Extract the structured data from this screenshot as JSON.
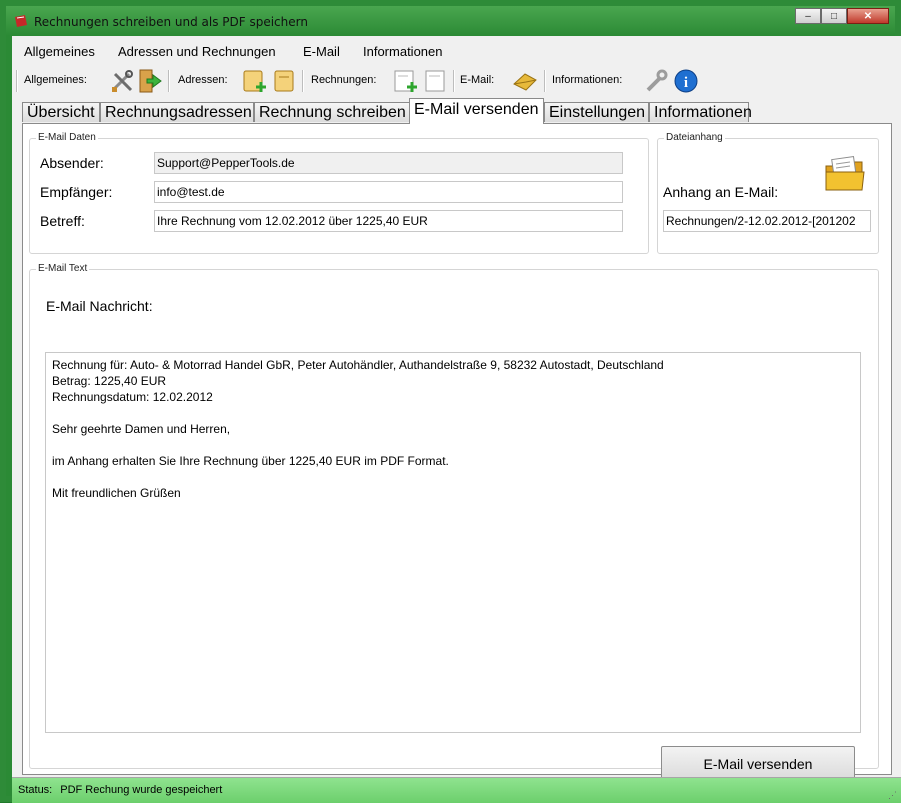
{
  "window": {
    "title": "Rechnungen schreiben und als PDF speichern",
    "minimize": "–",
    "maximize": "□",
    "close": "✕"
  },
  "menu": [
    "Allgemeines",
    "Adressen und Rechnungen",
    "E-Mail",
    "Informationen"
  ],
  "toolbar": {
    "general_label": "Allgemeines:",
    "addresses_label": "Adressen:",
    "invoices_label": "Rechnungen:",
    "email_label": "E-Mail:",
    "info_label": "Informationen:"
  },
  "tabs": [
    "Übersicht",
    "Rechnungsadressen",
    "Rechnung schreiben",
    "E-Mail versenden",
    "Einstellungen",
    "Informationen"
  ],
  "active_tab": "E-Mail versenden",
  "email_data": {
    "group_title": "E-Mail Daten",
    "sender_label": "Absender:",
    "sender_value": "Support@PepperTools.de",
    "recipient_label": "Empfänger:",
    "recipient_value": "info@test.de",
    "subject_label": "Betreff:",
    "subject_value": "Ihre Rechnung vom 12.02.2012 über 1225,40 EUR"
  },
  "attachment": {
    "group_title": "Dateianhang",
    "label": "Anhang an E-Mail:",
    "value": "Rechnungen/2-12.02.2012-[201202"
  },
  "email_text": {
    "group_title": "E-Mail Text",
    "message_label": "E-Mail Nachricht:",
    "lines": [
      "Rechnung für: Auto- & Motorrad Handel GbR, Peter Autohändler, Authandelstraße 9, 58232 Autostadt, Deutschland",
      "Betrag: 1225,40 EUR",
      "Rechnungsdatum: 12.02.2012",
      "",
      "Sehr geehrte Damen und Herren,",
      "",
      "im Anhang erhalten Sie Ihre Rechnung über 1225,40 EUR im PDF Format.",
      "",
      "Mit freundlichen Grüßen"
    ]
  },
  "send_button": "E-Mail versenden",
  "status": {
    "label": "Status:",
    "text": "PDF Rechung wurde gespeichert"
  },
  "colors": {
    "frame": "#2e8b38",
    "statusbar": "#7fdc7f",
    "info_blue": "#1f6fd1",
    "folder_yellow": "#f2c230"
  }
}
